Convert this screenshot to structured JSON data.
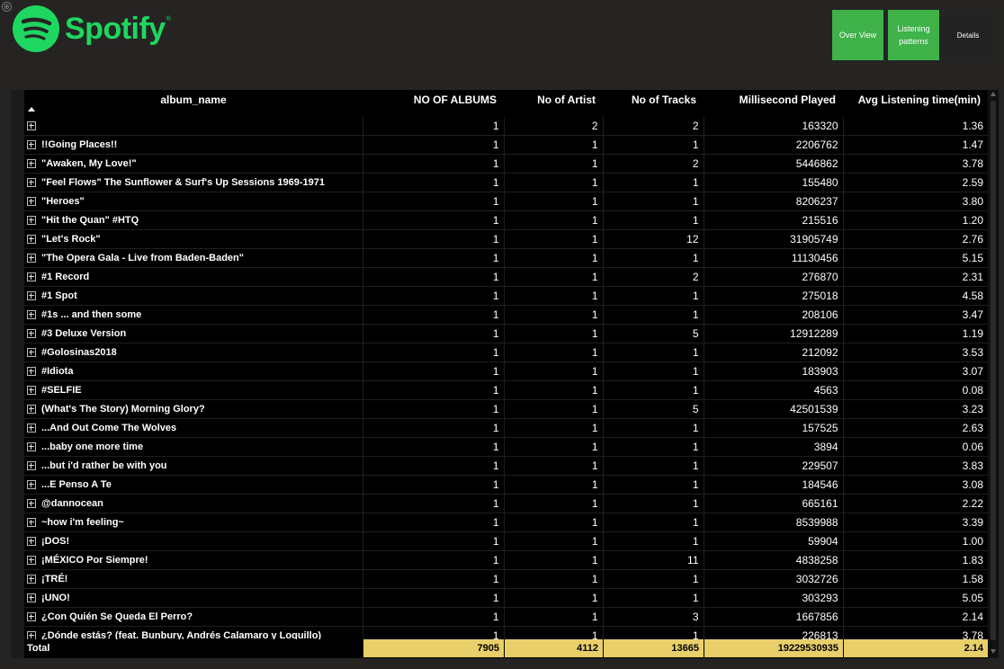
{
  "app": {
    "logo_text": "Spotify",
    "trademark": "®"
  },
  "nav": {
    "overview": "Over View",
    "listening": "Listening patterns",
    "details": "Details"
  },
  "colors": {
    "brand": "#1ed760",
    "nav_active": "#3fb24a",
    "total_fill": "#e8cf6a"
  },
  "table": {
    "headers": [
      "album_name",
      "NO OF ALBUMS",
      "No of Artist",
      "No of Tracks",
      "Millisecond Played",
      "Avg Listening time(min)"
    ],
    "rows": [
      [
        "",
        "1",
        "2",
        "2",
        "163320",
        "1.36"
      ],
      [
        "!!Going Places!!",
        "1",
        "1",
        "1",
        "2206762",
        "1.47"
      ],
      [
        "\"Awaken, My Love!\"",
        "1",
        "1",
        "2",
        "5446862",
        "3.78"
      ],
      [
        "\"Feel Flows\" The Sunflower & Surf's Up Sessions 1969-1971",
        "1",
        "1",
        "1",
        "155480",
        "2.59"
      ],
      [
        "\"Heroes\"",
        "1",
        "1",
        "1",
        "8206237",
        "3.80"
      ],
      [
        "\"Hit the Quan\" #HTQ",
        "1",
        "1",
        "1",
        "215516",
        "1.20"
      ],
      [
        "\"Let's Rock\"",
        "1",
        "1",
        "12",
        "31905749",
        "2.76"
      ],
      [
        "\"The Opera Gala - Live from Baden-Baden\"",
        "1",
        "1",
        "1",
        "11130456",
        "5.15"
      ],
      [
        "#1 Record",
        "1",
        "1",
        "2",
        "276870",
        "2.31"
      ],
      [
        "#1 Spot",
        "1",
        "1",
        "1",
        "275018",
        "4.58"
      ],
      [
        "#1s ... and then some",
        "1",
        "1",
        "1",
        "208106",
        "3.47"
      ],
      [
        "#3 Deluxe Version",
        "1",
        "1",
        "5",
        "12912289",
        "1.19"
      ],
      [
        "#Golosinas2018",
        "1",
        "1",
        "1",
        "212092",
        "3.53"
      ],
      [
        "#Idiota",
        "1",
        "1",
        "1",
        "183903",
        "3.07"
      ],
      [
        "#SELFIE",
        "1",
        "1",
        "1",
        "4563",
        "0.08"
      ],
      [
        "(What's The Story) Morning Glory?",
        "1",
        "1",
        "5",
        "42501539",
        "3.23"
      ],
      [
        "...And Out Come The Wolves",
        "1",
        "1",
        "1",
        "157525",
        "2.63"
      ],
      [
        "...baby one more time",
        "1",
        "1",
        "1",
        "3894",
        "0.06"
      ],
      [
        "...but i'd rather be with you",
        "1",
        "1",
        "1",
        "229507",
        "3.83"
      ],
      [
        "...E Penso A Te",
        "1",
        "1",
        "1",
        "184546",
        "3.08"
      ],
      [
        "@dannocean",
        "1",
        "1",
        "1",
        "665161",
        "2.22"
      ],
      [
        "~how i'm feeling~",
        "1",
        "1",
        "1",
        "8539988",
        "3.39"
      ],
      [
        "¡DOS!",
        "1",
        "1",
        "1",
        "59904",
        "1.00"
      ],
      [
        "¡MÉXICO Por Siempre!",
        "1",
        "1",
        "11",
        "4838258",
        "1.83"
      ],
      [
        "¡TRÉ!",
        "1",
        "1",
        "1",
        "3032726",
        "1.58"
      ],
      [
        "¡UNO!",
        "1",
        "1",
        "1",
        "303293",
        "5.05"
      ],
      [
        "¿Con Quién Se Queda El Perro?",
        "1",
        "1",
        "3",
        "1667856",
        "2.14"
      ],
      [
        "¿Dónde estás? (feat. Bunbury, Andrés Calamaro y Loquillo)",
        "1",
        "1",
        "1",
        "226813",
        "3.78"
      ]
    ],
    "total": {
      "label": "Total",
      "values": [
        "7905",
        "4112",
        "13665",
        "19229530935",
        "2.14"
      ]
    }
  }
}
